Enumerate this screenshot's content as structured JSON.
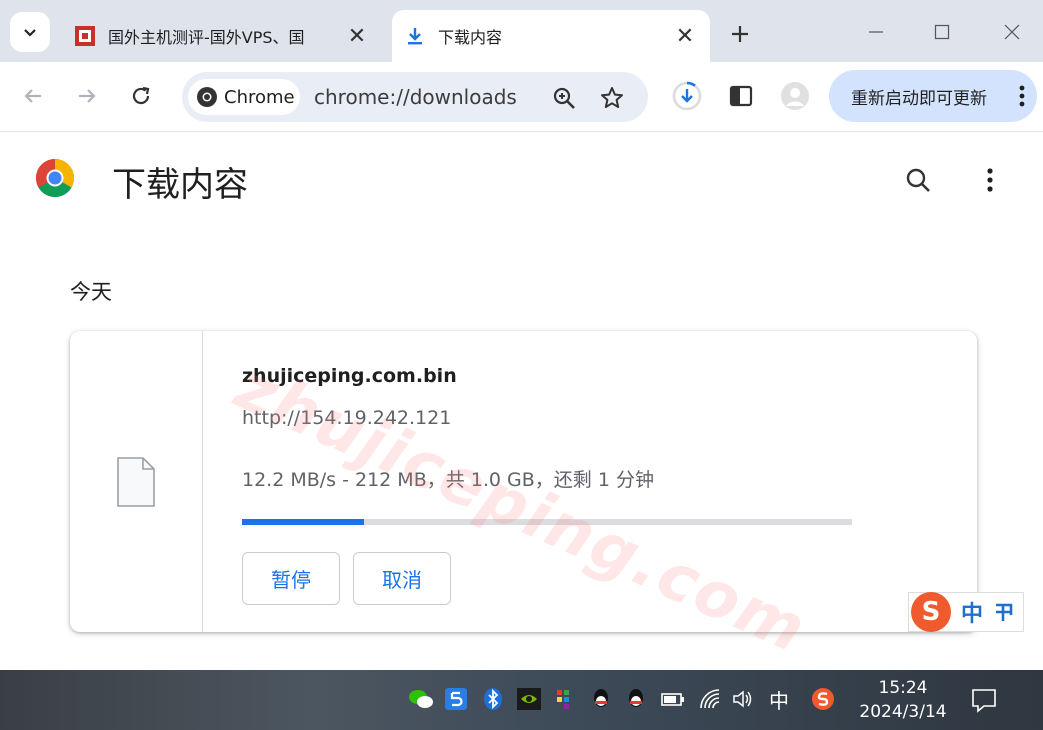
{
  "tabs": [
    {
      "title": "国外主机测评-国外VPS、国"
    },
    {
      "title": "下载内容"
    }
  ],
  "toolbar": {
    "chip_label": "Chrome",
    "url": "chrome://downloads",
    "update_label": "重新启动即可更新"
  },
  "page": {
    "title": "下载内容",
    "section_label": "今天"
  },
  "download": {
    "filename": "zhujiceping.com.bin",
    "source_url": "http://154.19.242.121",
    "status": "12.2 MB/s - 212 MB，共 1.0 GB，还剩 1 分钟",
    "progress_fraction": 0.2,
    "pause_label": "暂停",
    "cancel_label": "取消"
  },
  "watermark": "zhujiceping.com",
  "ime": {
    "logo": "S",
    "mode_label": "中"
  },
  "taskbar": {
    "input_lang": "中",
    "time": "15:24",
    "date": "2024/3/14"
  },
  "colors": {
    "accent": "#1a73e8",
    "update_bg": "#d3e3fd",
    "tabstrip_bg": "#dfe3eb"
  }
}
